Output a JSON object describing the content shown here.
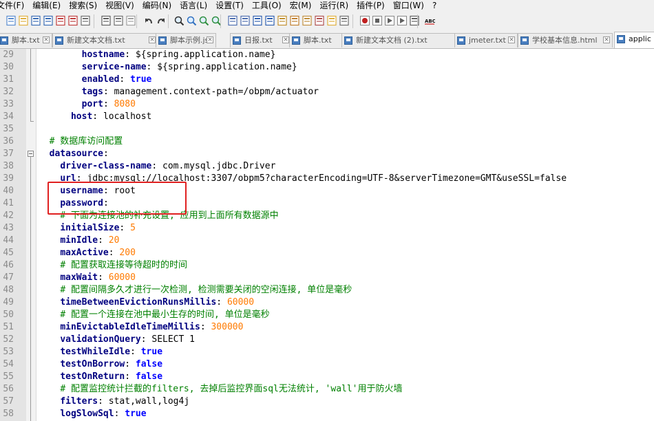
{
  "menu": [
    "文件(F)",
    "编辑(E)",
    "搜索(S)",
    "视图(V)",
    "编码(N)",
    "语言(L)",
    "设置(T)",
    "工具(O)",
    "宏(M)",
    "运行(R)",
    "插件(P)",
    "窗口(W)",
    "?"
  ],
  "toolbar": {
    "buttons": [
      "new-file",
      "open-file",
      "save",
      "save-all",
      "close",
      "close-all",
      "print",
      "cut",
      "copy",
      "paste",
      "undo",
      "redo",
      "find",
      "replace",
      "zoom-in",
      "zoom-out",
      "sync-vertical",
      "sync-horizontal",
      "word-wrap",
      "show-all-chars",
      "indent-guide",
      "define-language",
      "doc-map",
      "function-list",
      "folder-as-workspace",
      "monitoring",
      "record-macro",
      "stop-macro",
      "play-macro",
      "run-macro-multiple",
      "save-macro",
      "spell-check"
    ],
    "spell_check_label": "ABC"
  },
  "tabs": [
    {
      "label": "脚本.txt",
      "active": false
    },
    {
      "label": "新建文本文档.txt",
      "active": false
    },
    {
      "label": "脚本示例.js",
      "active": false
    },
    {
      "label": "日报.txt",
      "active": false
    },
    {
      "label": "脚本.txt",
      "active": false
    },
    {
      "label": "新建文本文档 (2).txt",
      "active": false
    },
    {
      "label": "jmeter.txt",
      "active": false
    },
    {
      "label": "学校基本信息.html",
      "active": false
    },
    {
      "label": "applic",
      "active": true
    }
  ],
  "editor": {
    "lines": [
      {
        "num": "29",
        "indent": "        ",
        "key": "hostname",
        "sep": ": ",
        "val": "${spring.application.name}",
        "vtype": "plain"
      },
      {
        "num": "30",
        "indent": "        ",
        "key": "service-name",
        "sep": ": ",
        "val": "${spring.application.name}",
        "vtype": "plain"
      },
      {
        "num": "31",
        "indent": "        ",
        "key": "enabled",
        "sep": ": ",
        "val": "true",
        "vtype": "bool"
      },
      {
        "num": "32",
        "indent": "        ",
        "key": "tags",
        "sep": ": ",
        "val": "management.context-path=/obpm/actuator",
        "vtype": "plain"
      },
      {
        "num": "33",
        "indent": "        ",
        "key": "port",
        "sep": ": ",
        "val": "8080",
        "vtype": "num"
      },
      {
        "num": "34",
        "indent": "      ",
        "key": "host",
        "sep": ": ",
        "val": "localhost",
        "vtype": "plain"
      },
      {
        "num": "35",
        "indent": "",
        "key": "",
        "sep": "",
        "val": "",
        "vtype": "plain"
      },
      {
        "num": "36",
        "indent": "  ",
        "comment": "# 数据库访问配置"
      },
      {
        "num": "37",
        "indent": "  ",
        "key": "datasource",
        "sep": ":",
        "val": "",
        "vtype": "plain",
        "fold": true
      },
      {
        "num": "38",
        "indent": "    ",
        "key": "driver-class-name",
        "sep": ": ",
        "val": "com.mysql.jdbc.Driver",
        "vtype": "plain"
      },
      {
        "num": "39",
        "indent": "    ",
        "key": "url",
        "sep": ": ",
        "val": "jdbc:mysql://localhost:3307/obpm5?characterEncoding=UTF-8&serverTimezone=GMT&useSSL=false",
        "vtype": "plain"
      },
      {
        "num": "40",
        "indent": "    ",
        "key": "username",
        "sep": ": ",
        "val": "root",
        "vtype": "plain"
      },
      {
        "num": "41",
        "indent": "    ",
        "key": "password",
        "sep": ":",
        "val": "",
        "vtype": "plain"
      },
      {
        "num": "42",
        "indent": "    ",
        "comment": "# 下面为连接池的补充设置, 应用到上面所有数据源中"
      },
      {
        "num": "43",
        "indent": "    ",
        "key": "initialSize",
        "sep": ": ",
        "val": "5",
        "vtype": "num"
      },
      {
        "num": "44",
        "indent": "    ",
        "key": "minIdle",
        "sep": ": ",
        "val": "20",
        "vtype": "num"
      },
      {
        "num": "45",
        "indent": "    ",
        "key": "maxActive",
        "sep": ": ",
        "val": "200",
        "vtype": "num"
      },
      {
        "num": "46",
        "indent": "    ",
        "comment": "# 配置获取连接等待超时的时间"
      },
      {
        "num": "47",
        "indent": "    ",
        "key": "maxWait",
        "sep": ": ",
        "val": "60000",
        "vtype": "num"
      },
      {
        "num": "48",
        "indent": "    ",
        "comment": "# 配置间隔多久才进行一次检测, 检测需要关闭的空闲连接, 单位是毫秒"
      },
      {
        "num": "49",
        "indent": "    ",
        "key": "timeBetweenEvictionRunsMillis",
        "sep": ": ",
        "val": "60000",
        "vtype": "num"
      },
      {
        "num": "50",
        "indent": "    ",
        "comment": "# 配置一个连接在池中最小生存的时间, 单位是毫秒"
      },
      {
        "num": "51",
        "indent": "    ",
        "key": "minEvictableIdleTimeMillis",
        "sep": ": ",
        "val": "300000",
        "vtype": "num"
      },
      {
        "num": "52",
        "indent": "    ",
        "key": "validationQuery",
        "sep": ": ",
        "val": "SELECT 1",
        "vtype": "plain"
      },
      {
        "num": "53",
        "indent": "    ",
        "key": "testWhileIdle",
        "sep": ": ",
        "val": "true",
        "vtype": "bool"
      },
      {
        "num": "54",
        "indent": "    ",
        "key": "testOnBorrow",
        "sep": ": ",
        "val": "false",
        "vtype": "bool"
      },
      {
        "num": "55",
        "indent": "    ",
        "key": "testOnReturn",
        "sep": ": ",
        "val": "false",
        "vtype": "bool"
      },
      {
        "num": "56",
        "indent": "    ",
        "comment": "# 配置监控统计拦截的filters, 去掉后监控界面sql无法统计, 'wall'用于防火墙"
      },
      {
        "num": "57",
        "indent": "    ",
        "key": "filters",
        "sep": ": ",
        "val": "stat,wall,log4j",
        "vtype": "plain"
      },
      {
        "num": "58",
        "indent": "    ",
        "key": "logSlowSql",
        "sep": ": ",
        "val": "true",
        "vtype": "bool"
      }
    ]
  },
  "colors": {
    "key": "#000080",
    "number": "#ff7a00",
    "boolean": "#0000ff",
    "comment": "#008000",
    "highlight_box": "#e02020"
  }
}
